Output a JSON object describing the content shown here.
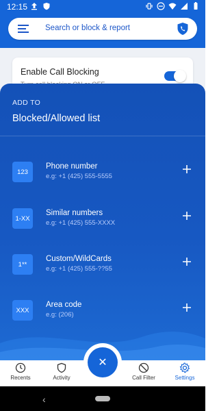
{
  "status_bar": {
    "time": "12:15"
  },
  "search": {
    "placeholder": "Search or block & report"
  },
  "background_card": {
    "title": "Enable Call Blocking",
    "subtitle": "Turn call blocking ON or OFF"
  },
  "sheet": {
    "add_to": "ADD TO",
    "title": "Blocked/Allowed list",
    "items": [
      {
        "badge": "123",
        "title": "Phone number",
        "example": "e.g: +1 (425) 555-5555"
      },
      {
        "badge": "1-XX",
        "title": "Similar numbers",
        "example": "e.g: +1 (425) 555-XXXX"
      },
      {
        "badge": "1**",
        "title": "Custom/WildCards",
        "example": "e.g: +1 (425) 555-??55"
      },
      {
        "badge": "XXX",
        "title": "Area code",
        "example": "e.g: (206)"
      }
    ]
  },
  "bottom_nav": {
    "items": [
      {
        "label": "Recents",
        "icon": "clock-icon"
      },
      {
        "label": "Activity",
        "icon": "shield-icon"
      },
      {
        "label": "Call Filter",
        "icon": "block-icon"
      },
      {
        "label": "Settings",
        "icon": "gear-icon"
      }
    ],
    "active": "Settings"
  },
  "fab": {
    "icon": "close-icon",
    "glyph": "✕"
  },
  "colors": {
    "primary": "#1565d8",
    "badge": "#2d7ff3",
    "sheet_top": "#1451b7"
  }
}
